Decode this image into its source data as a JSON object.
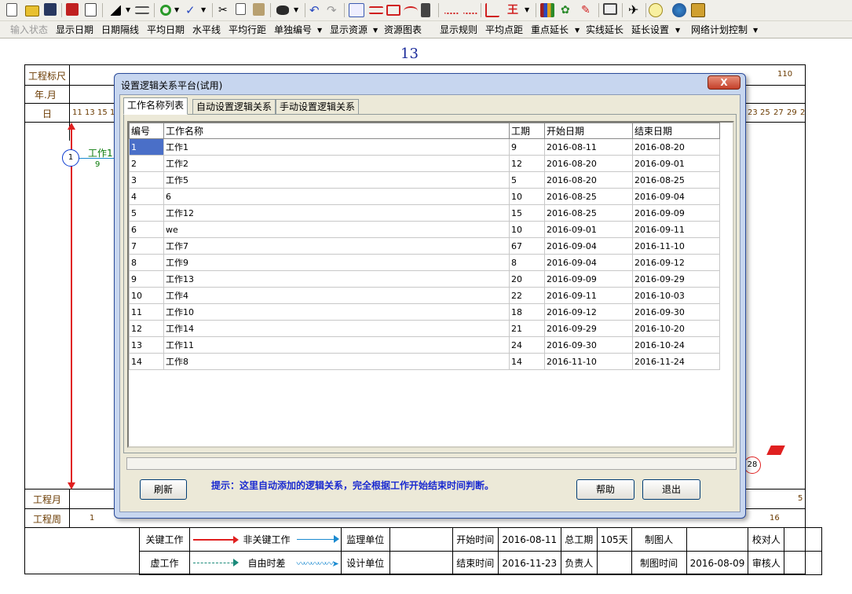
{
  "toolbar2": {
    "items": [
      "输入状态",
      "显示日期",
      "日期隔线",
      "平均日期",
      "水平线",
      "平均行距",
      "单独编号",
      "显示资源",
      "资源图表",
      "显示规则",
      "平均点距",
      "重点延长",
      "实线延长",
      "延长设置",
      "网络计划控制"
    ]
  },
  "page_number": "13",
  "ruler": {
    "row_labels": [
      "工程标尺",
      "年.月",
      "日",
      "工程月",
      "工程周"
    ],
    "scale_end": "110",
    "day_left": [
      "11",
      "13",
      "15",
      "1"
    ],
    "day_right": [
      "23",
      "25",
      "27",
      "29",
      "2"
    ],
    "week_left": "1",
    "week_right": "16",
    "month_right": "5"
  },
  "network": {
    "node_start": "1",
    "node_end": "28",
    "first_task": "工作1",
    "first_task_duration": "9"
  },
  "dialog": {
    "title": "设置逻辑关系平台(试用)",
    "close_label": "X",
    "tabs": [
      "工作名称列表",
      "自动设置逻辑关系",
      "手动设置逻辑关系"
    ],
    "columns": [
      "编号",
      "工作名称",
      "工期",
      "开始日期",
      "结束日期"
    ],
    "rows": [
      [
        "1",
        "工作1",
        "9",
        "2016-08-11",
        "2016-08-20"
      ],
      [
        "2",
        "工作2",
        "12",
        "2016-08-20",
        "2016-09-01"
      ],
      [
        "3",
        "工作5",
        "5",
        "2016-08-20",
        "2016-08-25"
      ],
      [
        "4",
        "6",
        "10",
        "2016-08-25",
        "2016-09-04"
      ],
      [
        "5",
        "工作12",
        "15",
        "2016-08-25",
        "2016-09-09"
      ],
      [
        "6",
        "we",
        "10",
        "2016-09-01",
        "2016-09-11"
      ],
      [
        "7",
        "工作7",
        "67",
        "2016-09-04",
        "2016-11-10"
      ],
      [
        "8",
        "工作9",
        "8",
        "2016-09-04",
        "2016-09-12"
      ],
      [
        "9",
        "工作13",
        "20",
        "2016-09-09",
        "2016-09-29"
      ],
      [
        "10",
        "工作4",
        "22",
        "2016-09-11",
        "2016-10-03"
      ],
      [
        "11",
        "工作10",
        "18",
        "2016-09-12",
        "2016-09-30"
      ],
      [
        "12",
        "工作14",
        "21",
        "2016-09-29",
        "2016-10-20"
      ],
      [
        "13",
        "工作11",
        "24",
        "2016-09-30",
        "2016-10-24"
      ],
      [
        "14",
        "工作8",
        "14",
        "2016-11-10",
        "2016-11-24"
      ]
    ],
    "refresh_label": "刷新",
    "tip": "提示：这里自动添加的逻辑关系，完全根据工作开始结束时间判断。",
    "help_label": "帮助",
    "exit_label": "退出"
  },
  "legend": {
    "critical": "关键工作",
    "noncritical": "非关键工作",
    "virtual": "虚工作",
    "float": "自由时差"
  },
  "info": {
    "supervisor": "监理单位",
    "designer": "设计单位",
    "start_label": "开始时间",
    "start_value": "2016-08-11",
    "end_label": "结束时间",
    "end_value": "2016-11-23",
    "duration_label": "总工期",
    "duration_value": "105天",
    "owner_label": "负责人",
    "drawer_label": "制图人",
    "draw_time_label": "制图时间",
    "draw_time_value": "2016-08-09",
    "checker_label": "校对人",
    "reviewer_label": "审核人"
  },
  "colors": {
    "critical": "#e02020",
    "noncritical": "#1a8ad0",
    "virtual": "#1a8a7a",
    "accent": "#1a2ad0"
  }
}
